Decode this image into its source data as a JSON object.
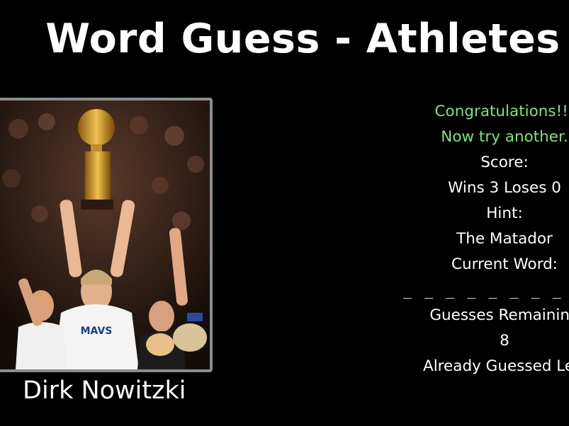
{
  "header": {
    "title": "Word Guess - Athletes"
  },
  "athlete": {
    "caption": "Dirk Nowitzki",
    "photo_alt": "players celebrating with championship trophy"
  },
  "status": {
    "message_line1": "Congratulations!!!",
    "message_line2": "Now try another.",
    "message_color": "#7fe37f"
  },
  "score": {
    "label": "Score:",
    "text": "Wins 3 Loses 0"
  },
  "hint": {
    "label": "Hint:",
    "text": "The Matador"
  },
  "current_word": {
    "label": "Current Word:",
    "blanks": "_ _ _ _    _ _ _ _ _ _"
  },
  "guesses": {
    "label": "Guesses Remaining",
    "remaining": "8"
  },
  "already_guessed": {
    "label": "Already Guessed Lett"
  }
}
